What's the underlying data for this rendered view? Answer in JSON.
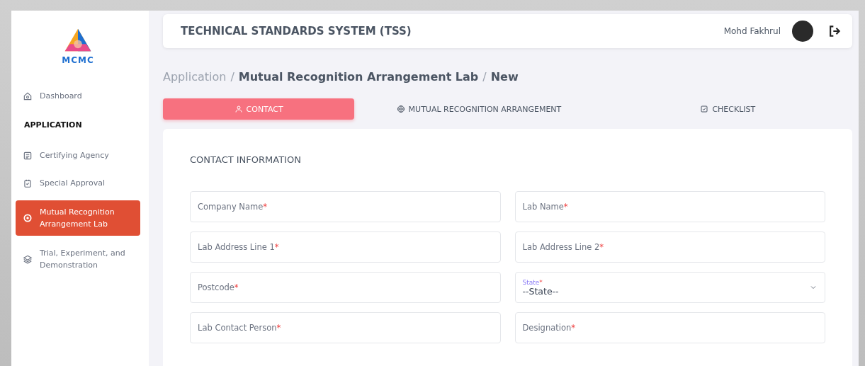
{
  "sidebar": {
    "logo_text": "MCMC",
    "items": [
      {
        "kind": "link",
        "label": "Dashboard",
        "selected": false
      },
      {
        "kind": "section",
        "label": "APPLICATION"
      },
      {
        "kind": "link",
        "label": "Certifying Agency",
        "selected": false
      },
      {
        "kind": "link",
        "label": "Special Approval",
        "selected": false
      },
      {
        "kind": "link",
        "label": "Mutual Recognition Arrangement Lab",
        "selected": true
      },
      {
        "kind": "link",
        "label": "Trial, Experiment, and Demonstration",
        "selected": false
      }
    ]
  },
  "header": {
    "title": "TECHNICAL STANDARDS SYSTEM (TSS)",
    "user": "Mohd Fakhrul"
  },
  "breadcrumb": [
    {
      "label": "Application",
      "current": false
    },
    {
      "label": "Mutual Recognition Arrangement Lab",
      "current": true
    },
    {
      "label": "New",
      "current": true
    }
  ],
  "breadcrumb_separator": "/",
  "tabs": [
    {
      "label": "CONTACT",
      "selected": true
    },
    {
      "label": "MUTUAL RECOGNITION ARRANGEMENT",
      "selected": false
    },
    {
      "label": "CHECKLIST",
      "selected": false
    }
  ],
  "section_title": "CONTACT INFORMATION",
  "fields": [
    {
      "kind": "text",
      "label": "Company Name",
      "mark": "*"
    },
    {
      "kind": "text",
      "label": "Lab Name",
      "mark": "*"
    },
    {
      "kind": "text",
      "label": "Lab Address Line 1",
      "mark": "*"
    },
    {
      "kind": "text",
      "label": "Lab Address Line 2",
      "mark": "*"
    },
    {
      "kind": "text",
      "label": "Postcode",
      "mark": "*"
    },
    {
      "kind": "select",
      "label": "State",
      "mark": "*",
      "value": "--State--"
    },
    {
      "kind": "text",
      "label": "Lab Contact Person",
      "mark": "*"
    },
    {
      "kind": "text",
      "label": "Designation",
      "mark": "*"
    }
  ]
}
